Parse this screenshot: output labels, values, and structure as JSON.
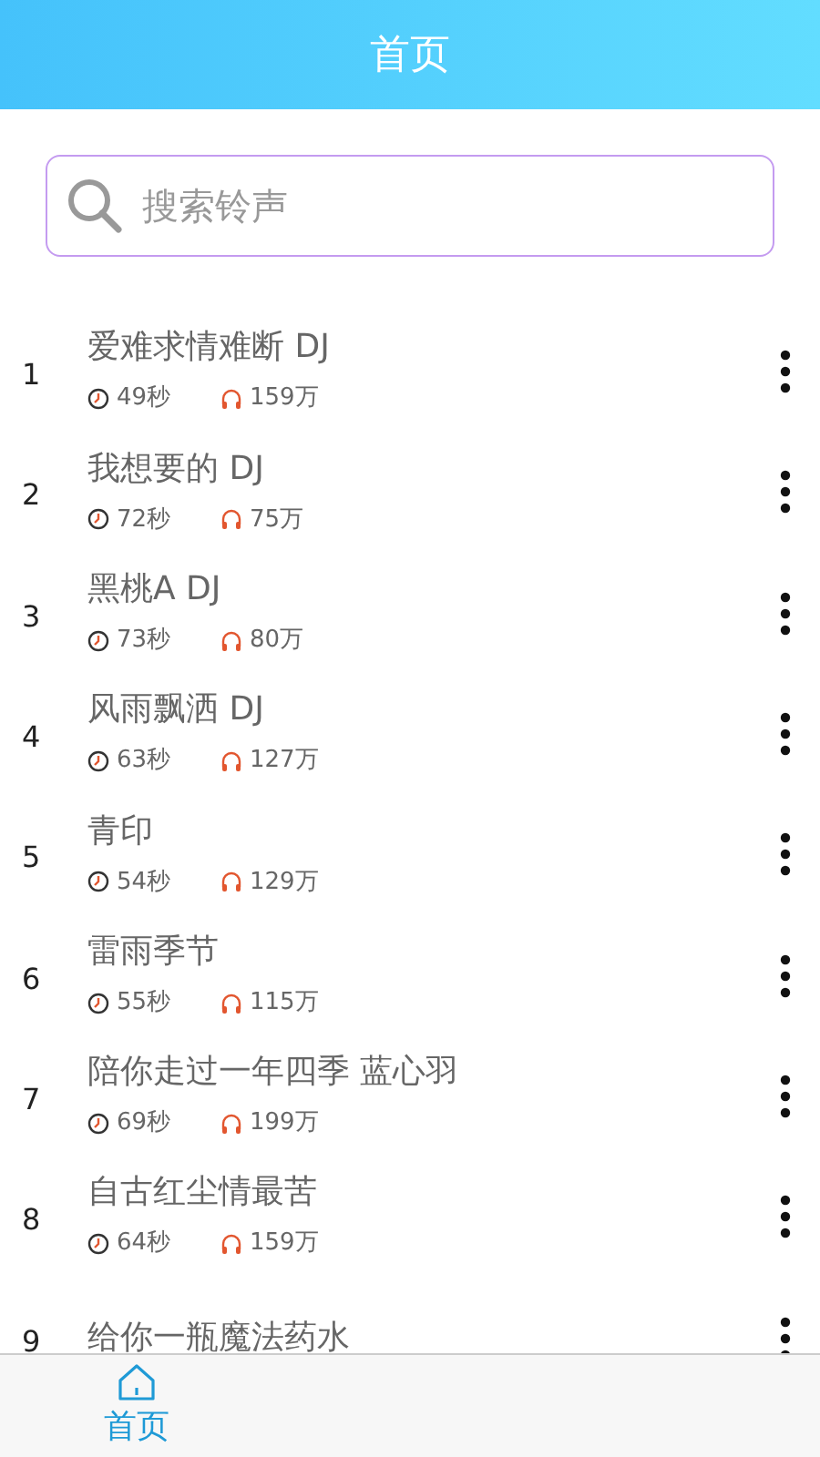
{
  "header": {
    "title": "首页"
  },
  "search": {
    "placeholder": "搜索铃声"
  },
  "songs": [
    {
      "index": "1",
      "title": "爱难求情难断 DJ",
      "duration": "49秒",
      "plays": "159万"
    },
    {
      "index": "2",
      "title": "我想要的 DJ",
      "duration": "72秒",
      "plays": "75万"
    },
    {
      "index": "3",
      "title": "黑桃A DJ",
      "duration": "73秒",
      "plays": "80万"
    },
    {
      "index": "4",
      "title": "风雨飘洒 DJ",
      "duration": "63秒",
      "plays": "127万"
    },
    {
      "index": "5",
      "title": "青印",
      "duration": "54秒",
      "plays": "129万"
    },
    {
      "index": "6",
      "title": "雷雨季节",
      "duration": "55秒",
      "plays": "115万"
    },
    {
      "index": "7",
      "title": "陪你走过一年四季 蓝心羽",
      "duration": "69秒",
      "plays": "199万"
    },
    {
      "index": "8",
      "title": "自古红尘情最苦",
      "duration": "64秒",
      "plays": "159万"
    },
    {
      "index": "9",
      "title": "给你一瓶魔法药水"
    }
  ],
  "tab_bar": [
    {
      "label": "首页",
      "selected": true
    }
  ]
}
